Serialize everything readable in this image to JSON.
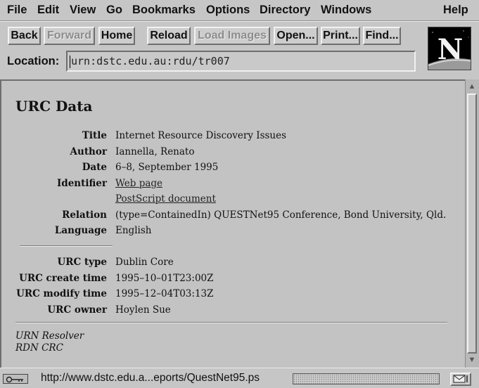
{
  "menubar": {
    "items": [
      "File",
      "Edit",
      "View",
      "Go",
      "Bookmarks",
      "Options",
      "Directory",
      "Windows"
    ],
    "help": "Help"
  },
  "toolbar": {
    "back": "Back",
    "forward": "Forward",
    "home": "Home",
    "reload": "Reload",
    "load_images": "Load Images",
    "open": "Open...",
    "print": "Print...",
    "find": "Find..."
  },
  "location": {
    "label": "Location:",
    "value": "urn:dstc.edu.au:rdu/tr007"
  },
  "page": {
    "heading": "URC Data",
    "fields": [
      {
        "label": "Title",
        "value": "Internet Resource Discovery Issues"
      },
      {
        "label": "Author",
        "value": "Iannella, Renato"
      },
      {
        "label": "Date",
        "value": "6–8, September 1995"
      },
      {
        "label": "Identifier",
        "value": "Web page"
      },
      {
        "label": "",
        "value": "PostScript document"
      },
      {
        "label": "Relation",
        "value": "(type=ContainedIn) QUESTNet95 Conference, Bond University, Qld."
      },
      {
        "label": "Language",
        "value": "English"
      }
    ],
    "meta": [
      {
        "label": "URC type",
        "value": "Dublin Core"
      },
      {
        "label": "URC create time",
        "value": "1995–10–01T23:00Z"
      },
      {
        "label": "URC modify time",
        "value": "1995–12–04T03:13Z"
      },
      {
        "label": "URC owner",
        "value": "Hoylen Sue"
      }
    ],
    "footer": [
      "URN Resolver",
      "RDN CRC"
    ]
  },
  "status": {
    "text": "http://www.dstc.edu.a...eports/QuestNet95.ps"
  },
  "colors": {
    "chrome": "#c6c6c6",
    "logo_bg": "#000000"
  }
}
